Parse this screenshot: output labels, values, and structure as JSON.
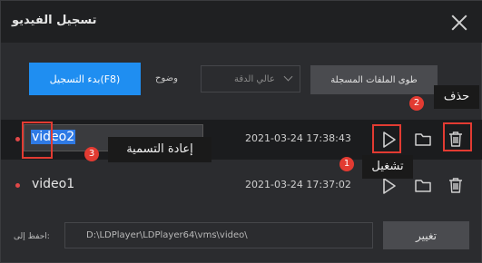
{
  "window": {
    "title": "تسجيل الفيديو",
    "close_icon": "close-icon"
  },
  "toolbar": {
    "record_label": "بدء التسجيل(F8)",
    "quality_label": "وضوح",
    "quality_value": "عالي الدقة",
    "collapse_label": "طوى الملفات المسجلة"
  },
  "recordings": [
    {
      "name": "video2",
      "timestamp": "2021-03-24 17:38:43"
    },
    {
      "name": "video1",
      "timestamp": "2021-03-24 17:37:02"
    }
  ],
  "annotations": {
    "rename": {
      "number": "3",
      "label": "إعادة التسمية"
    },
    "play": {
      "number": "1",
      "label": "تشغيل"
    },
    "delete": {
      "number": "2",
      "label": "حذف"
    }
  },
  "footer": {
    "save_label": "احفظ إلى:",
    "path": "D:\\LDPlayer\\LDPlayer64\\vms\\video\\",
    "change_label": "تغيير"
  },
  "colors": {
    "accent": "#1f8ef1",
    "annotation_red": "#e23b32",
    "background": "#2b2c2f"
  }
}
